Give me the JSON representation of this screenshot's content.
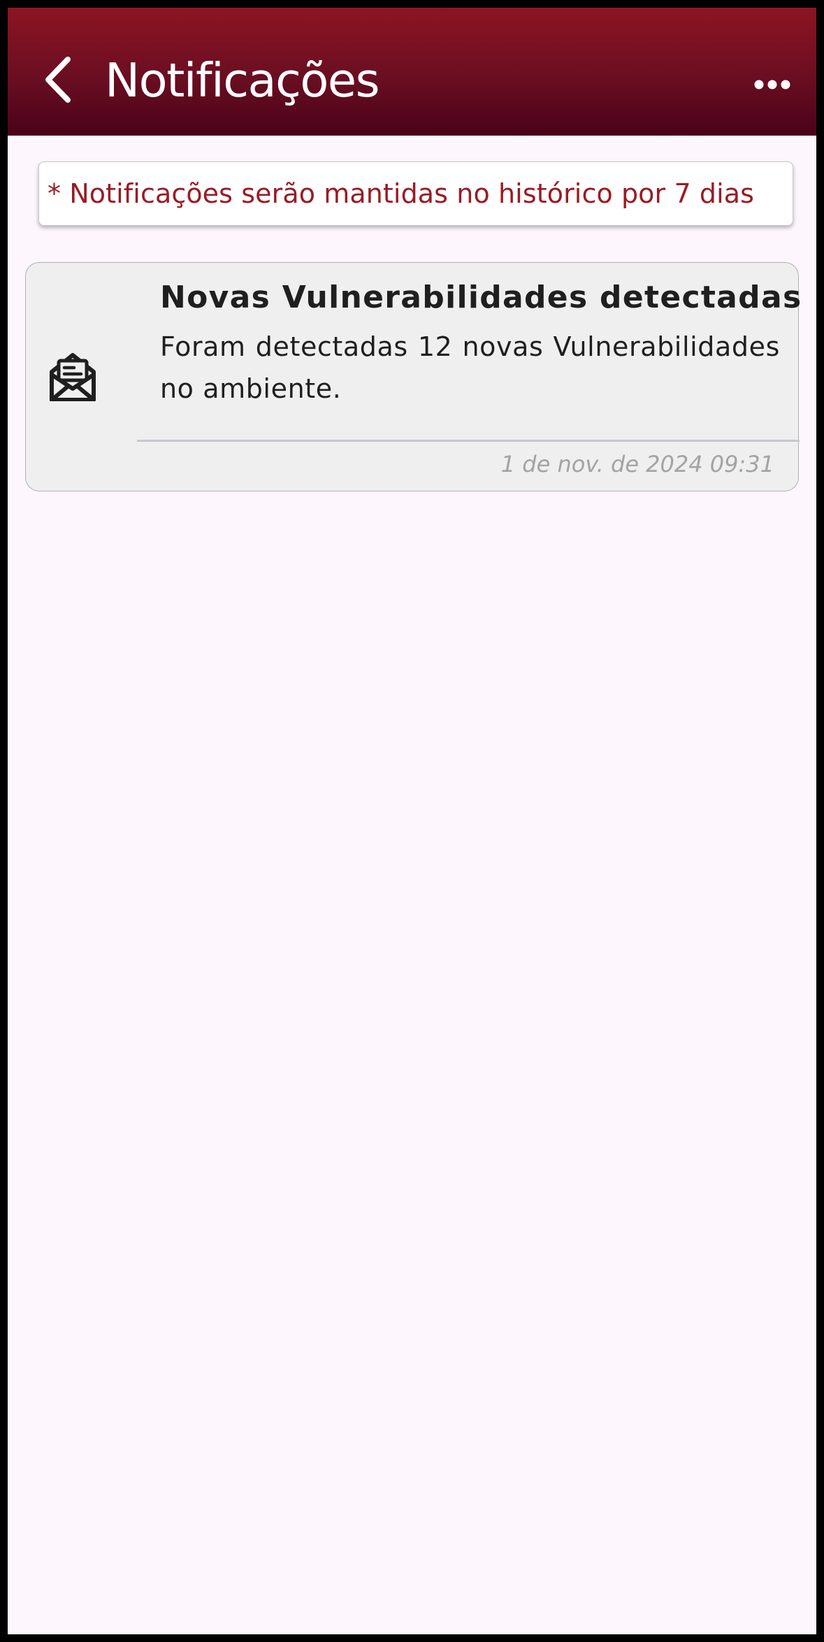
{
  "header": {
    "title": "Notificações",
    "back_icon": "chevron-left-icon",
    "more_icon": "more-horizontal-icon",
    "gradient_top": "#8c1522",
    "gradient_bottom": "#4a0219"
  },
  "notice": {
    "text": "* Notificações serão mantidas no histórico por 7 dias",
    "color": "#9a1b24"
  },
  "notifications": [
    {
      "icon": "envelope-open-icon",
      "title": "Novas Vulnerabilidades detectadas",
      "body": "Foram detectadas 12 novas Vulnerabilidades no ambiente.",
      "timestamp": "1 de nov. de 2024 09:31"
    }
  ],
  "colors": {
    "background": "#fdf6fd",
    "card_background": "#efefef",
    "accent": "#8c1522"
  }
}
